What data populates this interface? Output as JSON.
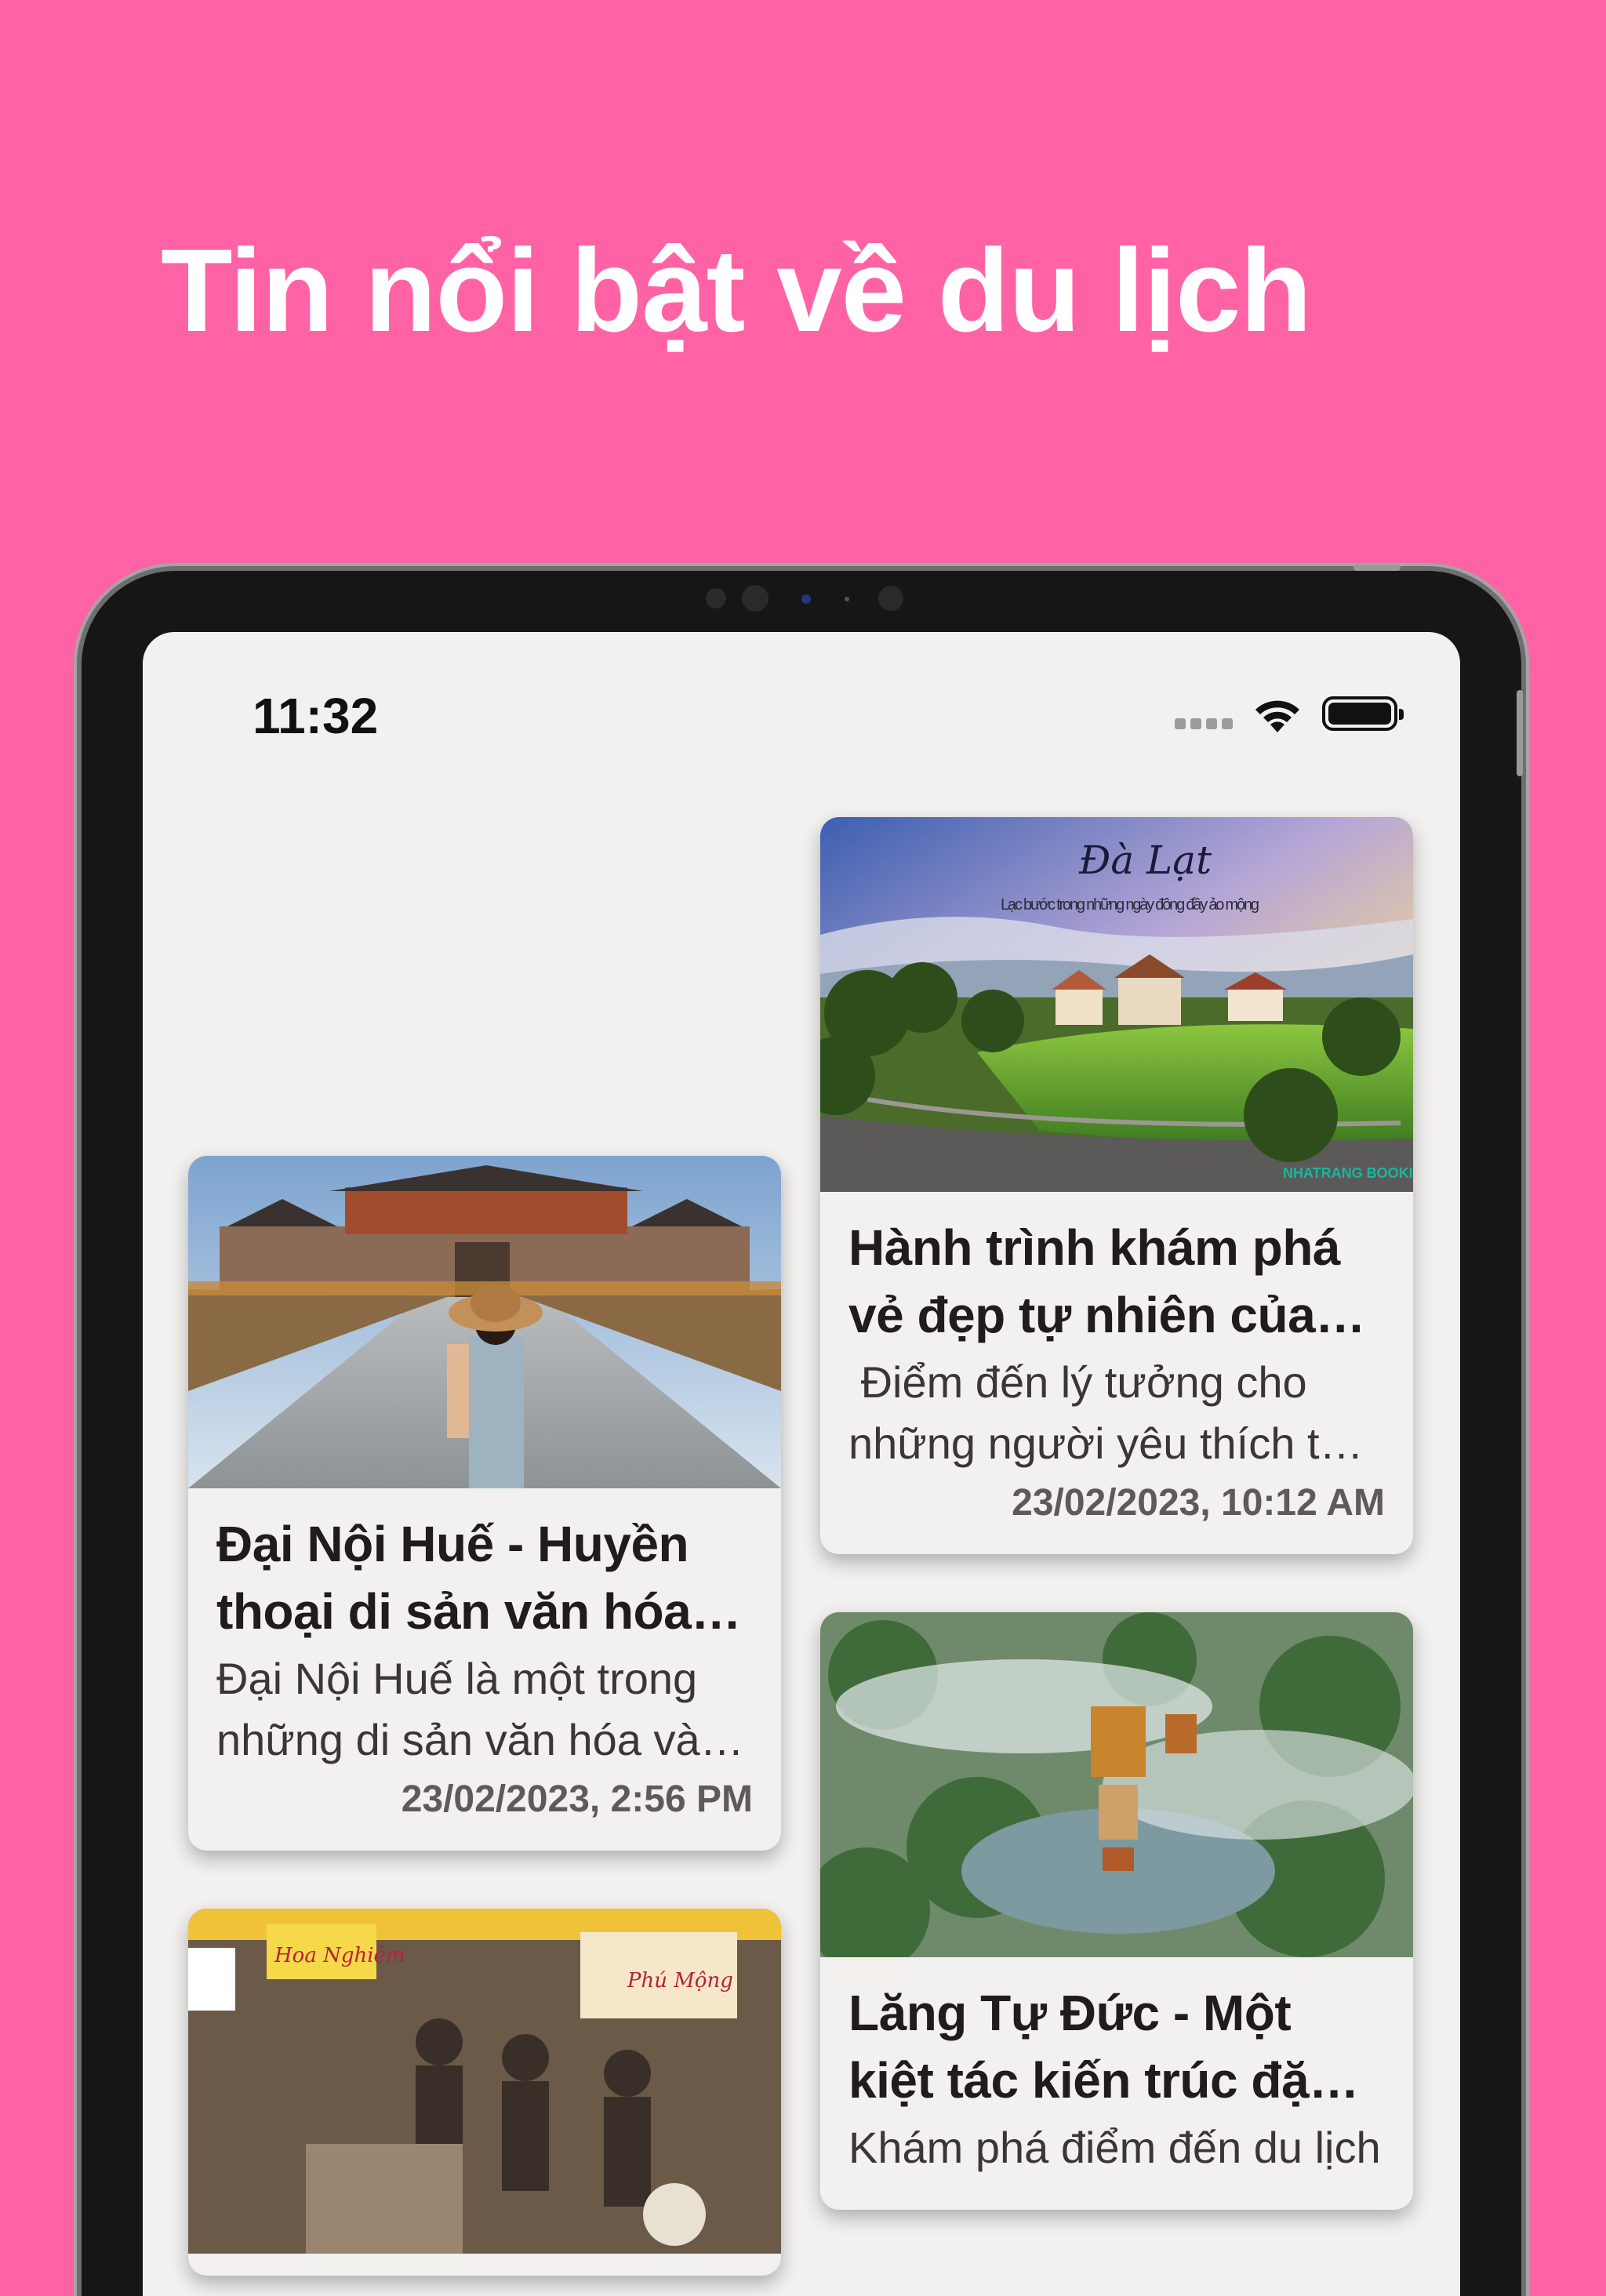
{
  "headline": "Tin nổi bật về du lịch",
  "status_bar": {
    "time": "11:32",
    "wifi_icon": "wifi-icon",
    "battery_icon": "battery-icon"
  },
  "articles": [
    {
      "title": "Đại Nội Huế - Huyền thoại di sản văn hóa…",
      "description": "Đại Nội Huế là một trong những di sản văn hóa và…",
      "date": "23/02/2023, 2:56 PM",
      "image_icon": "imperial-citadel-photo"
    },
    {
      "title": "Hành trình khám phá vẻ đẹp tự nhiên của…",
      "description": " Điểm đến lý tưởng cho những người yêu thích t…",
      "date": "23/02/2023, 10:12 AM",
      "image_icon": "dalat-landscape-photo",
      "image_caption_title": "Đà Lạt",
      "image_caption_subtitle": "Lạc bước trong những ngày đông đầy ảo mộng",
      "image_brand": "NHATRANG BOOKING"
    },
    {
      "title": "Lăng Tự Đức - Một kiệt tác kiến trúc đặ…",
      "description": "Khám phá điểm đến du lịch",
      "date": "",
      "image_icon": "tu-duc-tomb-aerial-photo"
    },
    {
      "title": "",
      "description": "",
      "date": "",
      "image_icon": "restaurant-photo",
      "image_sign_1": "Hoa Nghiêm",
      "image_sign_2": "Phú Mộng"
    }
  ],
  "colors": {
    "background": "#ff63a5",
    "screen": "#f2f1ef",
    "frame": "#161616"
  }
}
